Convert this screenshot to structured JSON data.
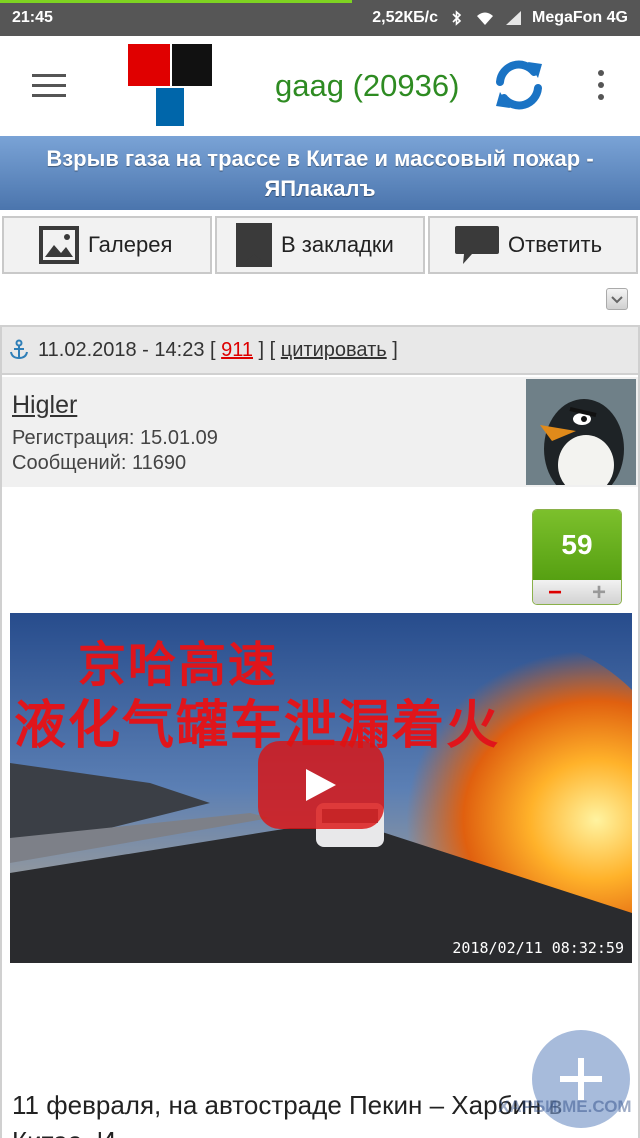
{
  "status_bar": {
    "time": "21:45",
    "net_speed": "2,52КБ/с",
    "carrier": "MegaFon 4G",
    "icons": [
      "bluetooth-icon",
      "wifi-icon",
      "signal-icon"
    ],
    "load_progress": 0.55
  },
  "app_bar": {
    "username": "gaag (20936)",
    "icons": [
      "menu-icon",
      "logo",
      "refresh-icon",
      "more-icon"
    ],
    "colors": {
      "username": "#2e8b22",
      "refresh": "#1a73c4"
    }
  },
  "title": "Взрыв газа на трассе в Китае и массовый пожар - ЯПлакалъ",
  "actions": {
    "gallery": "Галерея",
    "bookmark": "В закладки",
    "reply": "Ответить"
  },
  "post": {
    "date": "11.02.2018 - 14:23",
    "number": "911",
    "quote": "цитировать",
    "author": {
      "name": "Higler",
      "registration": "Регистрация: 15.01.09",
      "messages": "Сообщений: 11690"
    },
    "rating": {
      "value": "59",
      "minus": "−",
      "plus": "+"
    },
    "video": {
      "caption_line1": "京哈高速",
      "caption_line2": "液化气罐车泄漏着火",
      "timestamp": "2018/02/11  08:32:59"
    },
    "text": "11 февраля, на автостраде Пекин – Харбин в Китае. И..."
  },
  "watermark": "ХАРБИ.МЕ.СОМ"
}
